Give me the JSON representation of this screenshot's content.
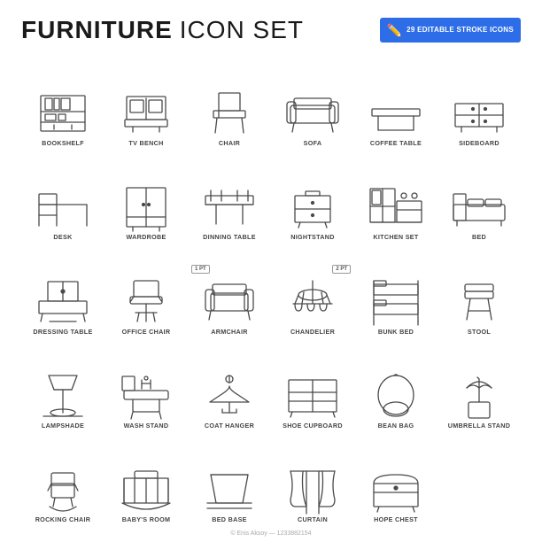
{
  "header": {
    "title_bold": "FURNITURE",
    "title_light": "ICON SET",
    "badge_line1": "29 EDITABLE STROKE ICONS"
  },
  "icons": [
    {
      "id": "bookshelf",
      "label": "BOOKSHELF"
    },
    {
      "id": "tv-bench",
      "label": "TV BENCH"
    },
    {
      "id": "chair",
      "label": "CHAIR"
    },
    {
      "id": "sofa",
      "label": "SOFA"
    },
    {
      "id": "coffee-table",
      "label": "COFFEE TABLE"
    },
    {
      "id": "sideboard",
      "label": "SIDEBOARD"
    },
    {
      "id": "desk",
      "label": "DESK"
    },
    {
      "id": "wardrobe",
      "label": "WARDROBE"
    },
    {
      "id": "dinning-table",
      "label": "DINNING TABLE"
    },
    {
      "id": "nightstand",
      "label": "NIGHTSTAND"
    },
    {
      "id": "kitchen-set",
      "label": "KITCHEN SET"
    },
    {
      "id": "bed",
      "label": "BED"
    },
    {
      "id": "dressing-table",
      "label": "DRESSING TABLE"
    },
    {
      "id": "office-chair",
      "label": "OFFICE CHAIR"
    },
    {
      "id": "armchair",
      "label": "ARMCHAIR"
    },
    {
      "id": "chandelier",
      "label": "CHANDELIER"
    },
    {
      "id": "bunk-bed",
      "label": "BUNK BED"
    },
    {
      "id": "stool",
      "label": "STOOL"
    },
    {
      "id": "lampshade",
      "label": "LAMPSHADE"
    },
    {
      "id": "wash-stand",
      "label": "WASH STAND"
    },
    {
      "id": "coat-hanger",
      "label": "COAT HANGER"
    },
    {
      "id": "shoe-cupboard",
      "label": "SHOE CUPBOARD"
    },
    {
      "id": "bean-bag",
      "label": "BEAN BAG"
    },
    {
      "id": "umbrella-stand",
      "label": "UMBRELLA STAND"
    },
    {
      "id": "rocking-chair",
      "label": "ROCKING CHAIR"
    },
    {
      "id": "babys-room",
      "label": "BABY'S ROOM"
    },
    {
      "id": "bed-base",
      "label": "BED BASE"
    },
    {
      "id": "curtain",
      "label": "CURTAIN"
    },
    {
      "id": "hope-chest",
      "label": "HOPE CHEST"
    }
  ],
  "watermark": "© Enis Aksoy — 1233882154"
}
